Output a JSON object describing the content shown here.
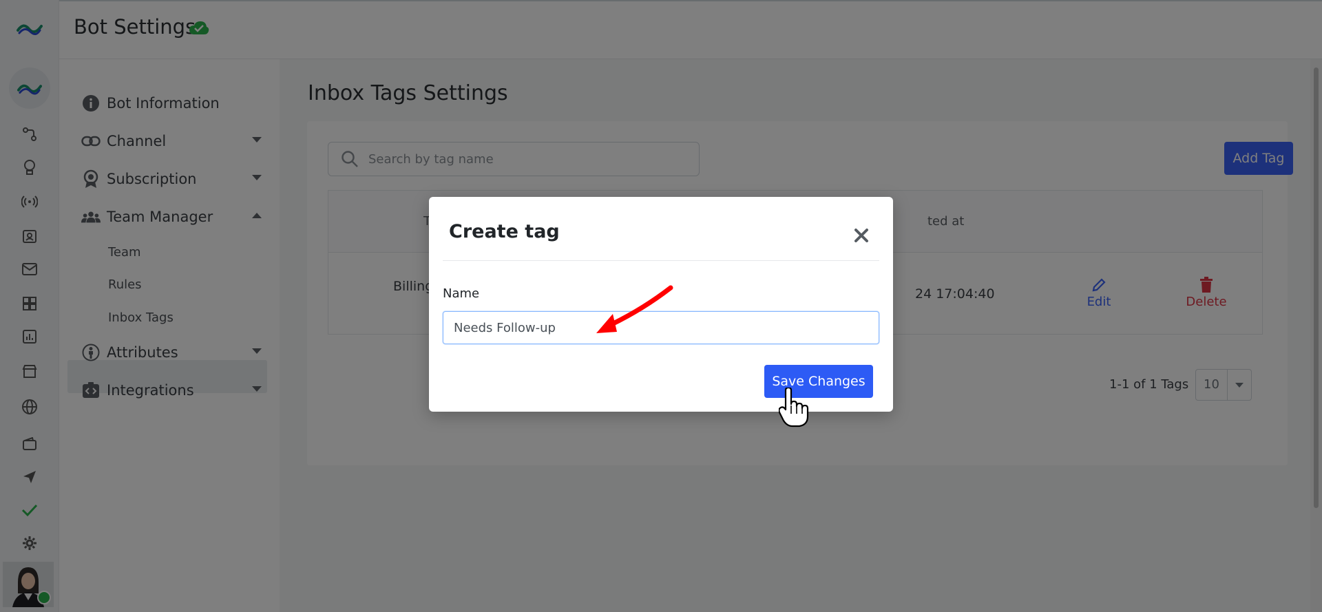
{
  "app": {
    "title": "Bot Settings"
  },
  "sidebar_menu": {
    "items": [
      {
        "label": "Bot Information",
        "icon": "info-icon"
      },
      {
        "label": "Channel",
        "icon": "link-icon"
      },
      {
        "label": "Subscription",
        "icon": "award-icon"
      },
      {
        "label": "Team Manager",
        "icon": "users-icon"
      },
      {
        "label": "Attributes",
        "icon": "person-icon"
      },
      {
        "label": "Integrations",
        "icon": "code-icon"
      }
    ],
    "sub_items": [
      {
        "label": "Team"
      },
      {
        "label": "Rules"
      },
      {
        "label": "Inbox Tags"
      }
    ]
  },
  "page": {
    "heading": "Inbox Tags Settings",
    "search_placeholder": "Search by tag name",
    "add_tag_label": "Add Tag",
    "table": {
      "header_partial_1": "T",
      "header_partial_2": "ted at",
      "row": {
        "name_partial": "Billing",
        "date_partial": "24 17:04:40",
        "edit_label": "Edit",
        "delete_label": "Delete"
      }
    },
    "pagination": {
      "summary": "1-1 of 1 Tags",
      "page_size": "10"
    }
  },
  "modal": {
    "title": "Create tag",
    "name_label": "Name",
    "name_value": "Needs Follow-up",
    "save_label": "Save Changes"
  },
  "colors": {
    "primary": "#2d5bf5",
    "danger": "#dc3545",
    "success": "#2bb24c",
    "annotation": "#ff0000"
  }
}
